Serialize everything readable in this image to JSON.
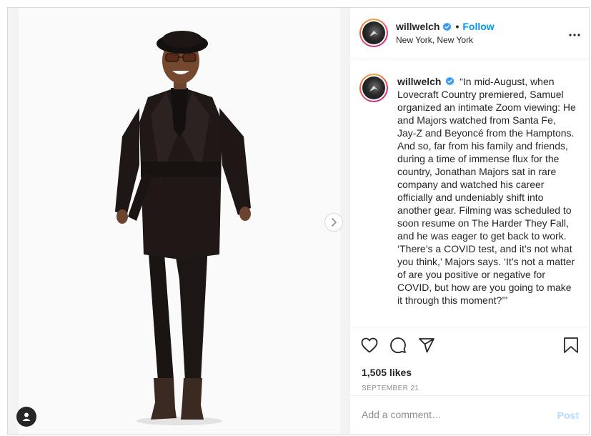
{
  "post": {
    "username": "willwelch",
    "follow_label": "Follow",
    "location": "New York, New York",
    "caption": "“In mid-August, when Lovecraft Country premiered, Samuel organized an intimate Zoom viewing: He and Majors watched from Santa Fe, Jay-Z and Beyoncé from the Hamptons. And so, far from his family and friends, during a time of immense flux for the country, Jonathan Majors sat in rare company and watched his career officially and undeniably shift into another gear. Filming was scheduled to soon resume on The Harder They Fall, and he was eager to get back to work. ‘There’s a COVID test, and it’s not what you think,’ Majors says. ‘It’s not a matter of are you positive or negative for COVID, but how are you going to make it through this moment?’”",
    "likes": "1,505 likes",
    "date": "SEPTEMBER 21"
  },
  "comment": {
    "placeholder": "Add a comment…",
    "post_label": "Post"
  },
  "icons": {
    "verified": "verified-badge-icon",
    "more": "more-options-icon",
    "like": "heart-icon",
    "comment": "comment-icon",
    "share": "share-icon",
    "save": "bookmark-icon",
    "next": "chevron-right-icon",
    "tag": "user-tag-icon"
  },
  "colors": {
    "accent": "#0095f6",
    "post_disabled": "#b3dbff",
    "muted": "#8e8e8e",
    "border": "#dbdbdb"
  }
}
